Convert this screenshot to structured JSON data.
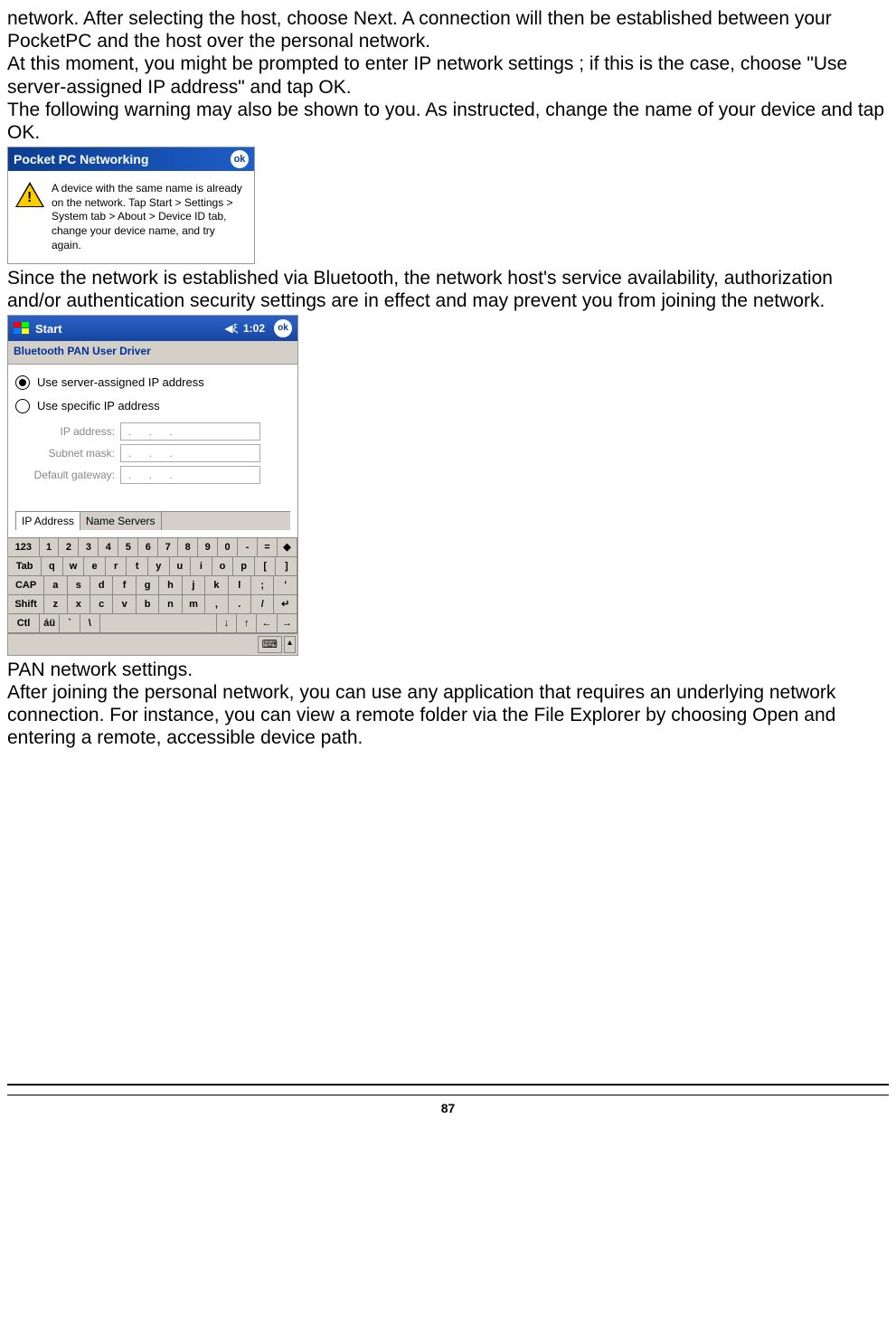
{
  "paragraphs": {
    "p1": "network. After selecting the host, choose Next. A connection will then be established between your PocketPC and the host over the personal network.",
    "p2": "At this moment, you might be prompted to enter IP network settings ; if this is the case, choose \"Use server-assigned IP address\" and tap OK.",
    "p3": "The following warning may also be shown to you. As instructed, change the name of your device and tap OK.",
    "p4": "Since the network is established via Bluetooth, the network host's service availability, authorization and/or authentication security settings are in effect and may prevent you from joining the network.",
    "p5": "PAN network settings.",
    "p6": "After joining the personal network, you can use any application that requires an underlying network connection. For instance, you can view a remote folder via the File Explorer by choosing Open and entering a remote, accessible device path."
  },
  "dialog1": {
    "title": "Pocket PC Networking",
    "ok": "ok",
    "message": "A device with the same name is already on the network. Tap Start > Settings > System tab > About > Device ID tab, change your device name, and try again."
  },
  "dialog2": {
    "start": "Start",
    "time": "1:02",
    "ok": "ok",
    "header": "Bluetooth PAN User Driver",
    "radio1": "Use server-assigned IP address",
    "radio2": "Use specific IP address",
    "ip_label": "IP address:",
    "subnet_label": "Subnet mask:",
    "gateway_label": "Default gateway:",
    "dots": ".   .   .",
    "tab1": "IP Address",
    "tab2": "Name Servers",
    "keyboard": {
      "row1": [
        "123",
        "1",
        "2",
        "3",
        "4",
        "5",
        "6",
        "7",
        "8",
        "9",
        "0",
        "-",
        "=",
        "◆"
      ],
      "row2": [
        "Tab",
        "q",
        "w",
        "e",
        "r",
        "t",
        "y",
        "u",
        "i",
        "o",
        "p",
        "[",
        "]"
      ],
      "row3": [
        "CAP",
        "a",
        "s",
        "d",
        "f",
        "g",
        "h",
        "j",
        "k",
        "l",
        ";",
        "'"
      ],
      "row4": [
        "Shift",
        "z",
        "x",
        "c",
        "v",
        "b",
        "n",
        "m",
        ",",
        ".",
        "/",
        "↵"
      ],
      "row5": [
        "Ctl",
        "áü",
        "`",
        "\\",
        "",
        "↓",
        "↑",
        "←",
        "→"
      ]
    }
  },
  "page_number": "87"
}
